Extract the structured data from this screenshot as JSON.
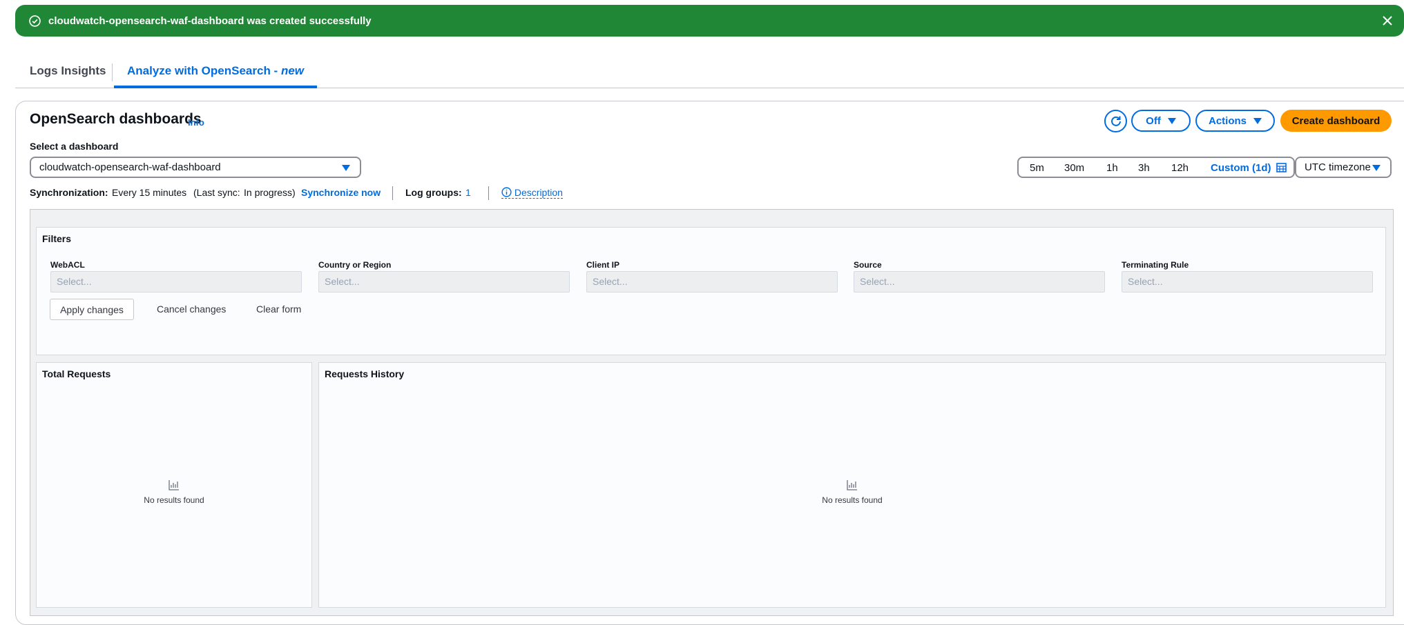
{
  "flash": {
    "message": "cloudwatch-opensearch-waf-dashboard was created successfully"
  },
  "tabs": {
    "logs_insights": "Logs Insights",
    "analyze": "Analyze with OpenSearch - ",
    "analyze_new": "new"
  },
  "header": {
    "title": "OpenSearch dashboards",
    "info": "Info",
    "refresh_interval": "Off",
    "actions": "Actions",
    "create": "Create dashboard"
  },
  "dashboard_select": {
    "label": "Select a dashboard",
    "value": "cloudwatch-opensearch-waf-dashboard"
  },
  "time_range": {
    "options": [
      "5m",
      "30m",
      "1h",
      "3h",
      "12h"
    ],
    "custom": "Custom (1d)",
    "timezone": "UTC timezone"
  },
  "sync": {
    "label": "Synchronization:",
    "interval": "Every 15 minutes",
    "last_sync_label": "(Last sync:",
    "last_sync_value": "In progress)",
    "sync_now": "Synchronize now",
    "log_groups_label": "Log groups:",
    "log_groups_count": "1",
    "description": "Description"
  },
  "filters": {
    "title": "Filters",
    "fields": [
      {
        "label": "WebACL",
        "placeholder": "Select..."
      },
      {
        "label": "Country or Region",
        "placeholder": "Select..."
      },
      {
        "label": "Client IP",
        "placeholder": "Select..."
      },
      {
        "label": "Source",
        "placeholder": "Select..."
      },
      {
        "label": "Terminating Rule",
        "placeholder": "Select..."
      }
    ],
    "apply": "Apply changes",
    "cancel": "Cancel changes",
    "clear": "Clear form"
  },
  "panels": {
    "total_requests": {
      "title": "Total Requests",
      "empty": "No results found"
    },
    "requests_history": {
      "title": "Requests History",
      "empty": "No results found"
    }
  }
}
